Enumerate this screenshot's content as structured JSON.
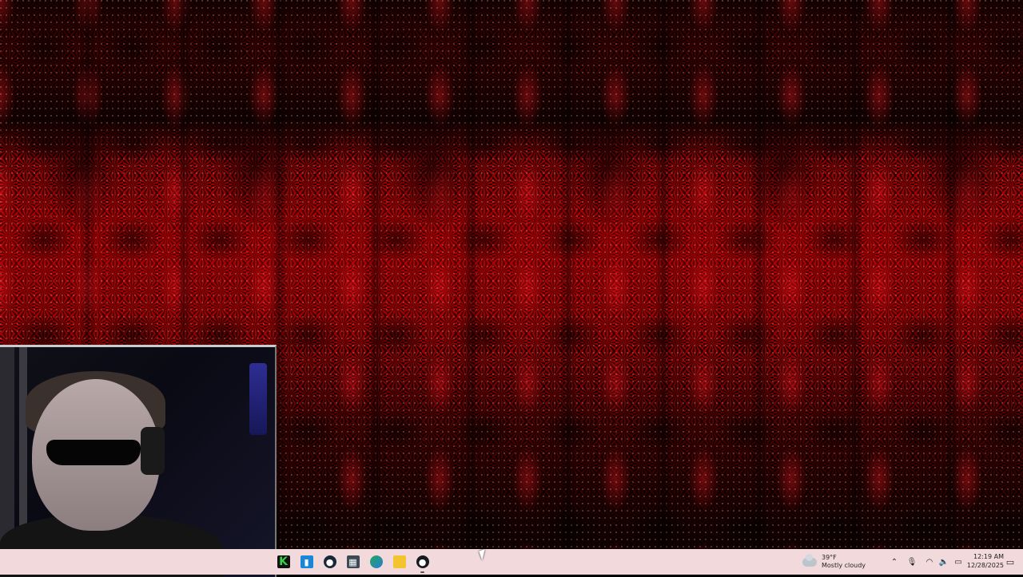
{
  "desktop": {
    "wallpaper": "red-black-kaleidoscope-pattern",
    "accent_colors": [
      "#9d0010",
      "#140000"
    ]
  },
  "webcam": {
    "subject": "webcam-overlay"
  },
  "taskbar": {
    "color": "#f1d9dc",
    "apps": [
      {
        "name": "k-app-icon",
        "glyph": "K"
      },
      {
        "name": "store-icon",
        "glyph": "🛍"
      },
      {
        "name": "steam-icon",
        "glyph": "◉"
      },
      {
        "name": "calculator-icon",
        "glyph": "▦"
      },
      {
        "name": "edge-icon",
        "glyph": "◐"
      },
      {
        "name": "file-explorer-icon",
        "glyph": ""
      },
      {
        "name": "steam-running-icon",
        "glyph": "◉"
      }
    ],
    "weather": {
      "temp": "39°F",
      "condition": "Mostly cloudy"
    },
    "tray": {
      "chevron": "^",
      "mic": "🎙",
      "wifi": "📶",
      "volume": "🔊",
      "battery": "🔋"
    },
    "clock": {
      "time": "12:19 AM",
      "date": "12/28/2025"
    },
    "notifications": "🗨"
  }
}
